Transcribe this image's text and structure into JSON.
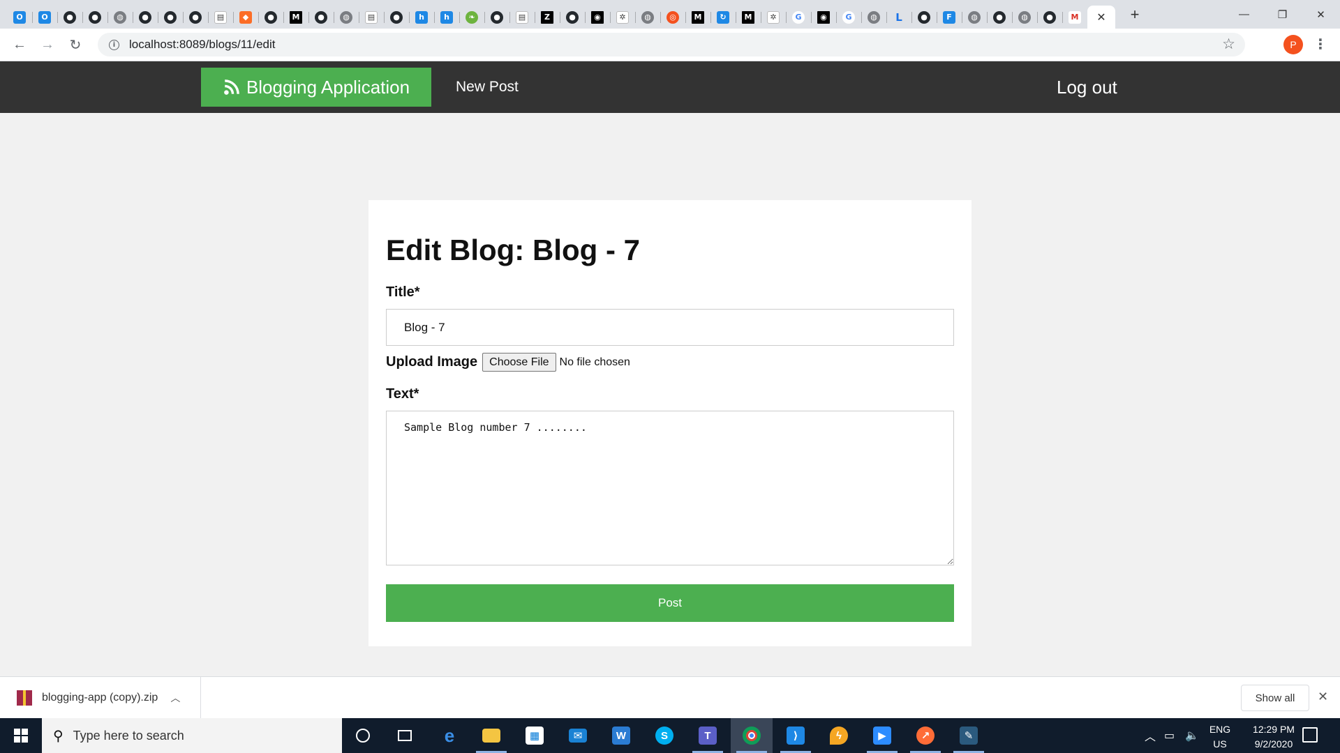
{
  "browser": {
    "url": "localhost:8089/blogs/11/edit",
    "pinned_tabs": [
      "outlook-icon",
      "outlook-icon",
      "github-icon",
      "github-icon",
      "globe-icon",
      "github-icon",
      "github-icon",
      "github-icon",
      "doc-icon",
      "gitlab-icon",
      "github-icon",
      "medium-icon",
      "github-icon",
      "globe-icon",
      "doc-icon",
      "github-icon",
      "blue-app-icon",
      "blue-app-icon",
      "spring-icon",
      "github-icon",
      "doc-icon",
      "z-icon",
      "github-icon",
      "app-icon",
      "gear-icon",
      "globe-icon",
      "orange-icon",
      "medium-icon",
      "refresh-icon",
      "medium-icon",
      "gear-icon",
      "google-icon",
      "app-icon",
      "google-icon",
      "globe-icon",
      "letter-icon",
      "github-icon",
      "facebook-icon",
      "globe-icon",
      "github-icon",
      "globe-icon",
      "github-icon",
      "gmail-icon"
    ],
    "profile_initial": "P"
  },
  "app": {
    "brand": "Blogging Application",
    "nav_new_post": "New Post",
    "nav_logout": "Log out",
    "accent": "#4caf50",
    "nav_bg": "#333333"
  },
  "form": {
    "heading": "Edit Blog: Blog - 7",
    "title_label": "Title*",
    "title_value": "Blog - 7",
    "upload_label": "Upload Image",
    "choose_file": "Choose File",
    "no_file": "No file chosen",
    "text_label": "Text*",
    "text_value": "Sample Blog number 7 ........",
    "submit": "Post"
  },
  "downloads": {
    "file_name": "blogging-app (copy).zip",
    "show_all": "Show all"
  },
  "taskbar": {
    "search_placeholder": "Type here to search",
    "lang_line1": "ENG",
    "lang_line2": "US",
    "time": "12:29 PM",
    "date": "9/2/2020"
  }
}
